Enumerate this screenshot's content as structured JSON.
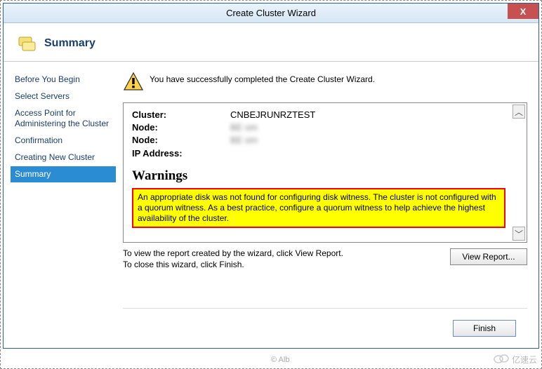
{
  "titlebar": {
    "title": "Create Cluster Wizard",
    "close": "X"
  },
  "header": {
    "title": "Summary"
  },
  "sidebar": {
    "items": [
      {
        "label": "Before You Begin"
      },
      {
        "label": "Select Servers"
      },
      {
        "label": "Access Point for Administering the Cluster"
      },
      {
        "label": "Confirmation"
      },
      {
        "label": "Creating New Cluster"
      },
      {
        "label": "Summary"
      }
    ],
    "activeIndex": 5
  },
  "main": {
    "successMessage": "You have successfully completed the Create Cluster Wizard.",
    "report": {
      "rows": [
        {
          "label": "Cluster:",
          "value": "CNBEJRUNRZTEST",
          "blurred": false
        },
        {
          "label": "Node:",
          "value": "BE                          om",
          "blurred": true
        },
        {
          "label": "Node:",
          "value": "BE                          om",
          "blurred": true
        },
        {
          "label": "IP Address:",
          "value": "                            ",
          "blurred": true
        }
      ],
      "warningsHeading": "Warnings",
      "warningText": "An appropriate disk was not found for configuring disk witness. The cluster is not configured with a quorum witness. As a best practice, configure a quorum witness to help achieve the highest availability of the cluster."
    },
    "footer": {
      "line1": "To view the report created by the wizard, click View Report.",
      "line2": "To close this wizard, click Finish.",
      "viewReport": "View Report...",
      "finish": "Finish"
    }
  },
  "watermark": {
    "left": "© Alb",
    "right": "亿速云"
  }
}
